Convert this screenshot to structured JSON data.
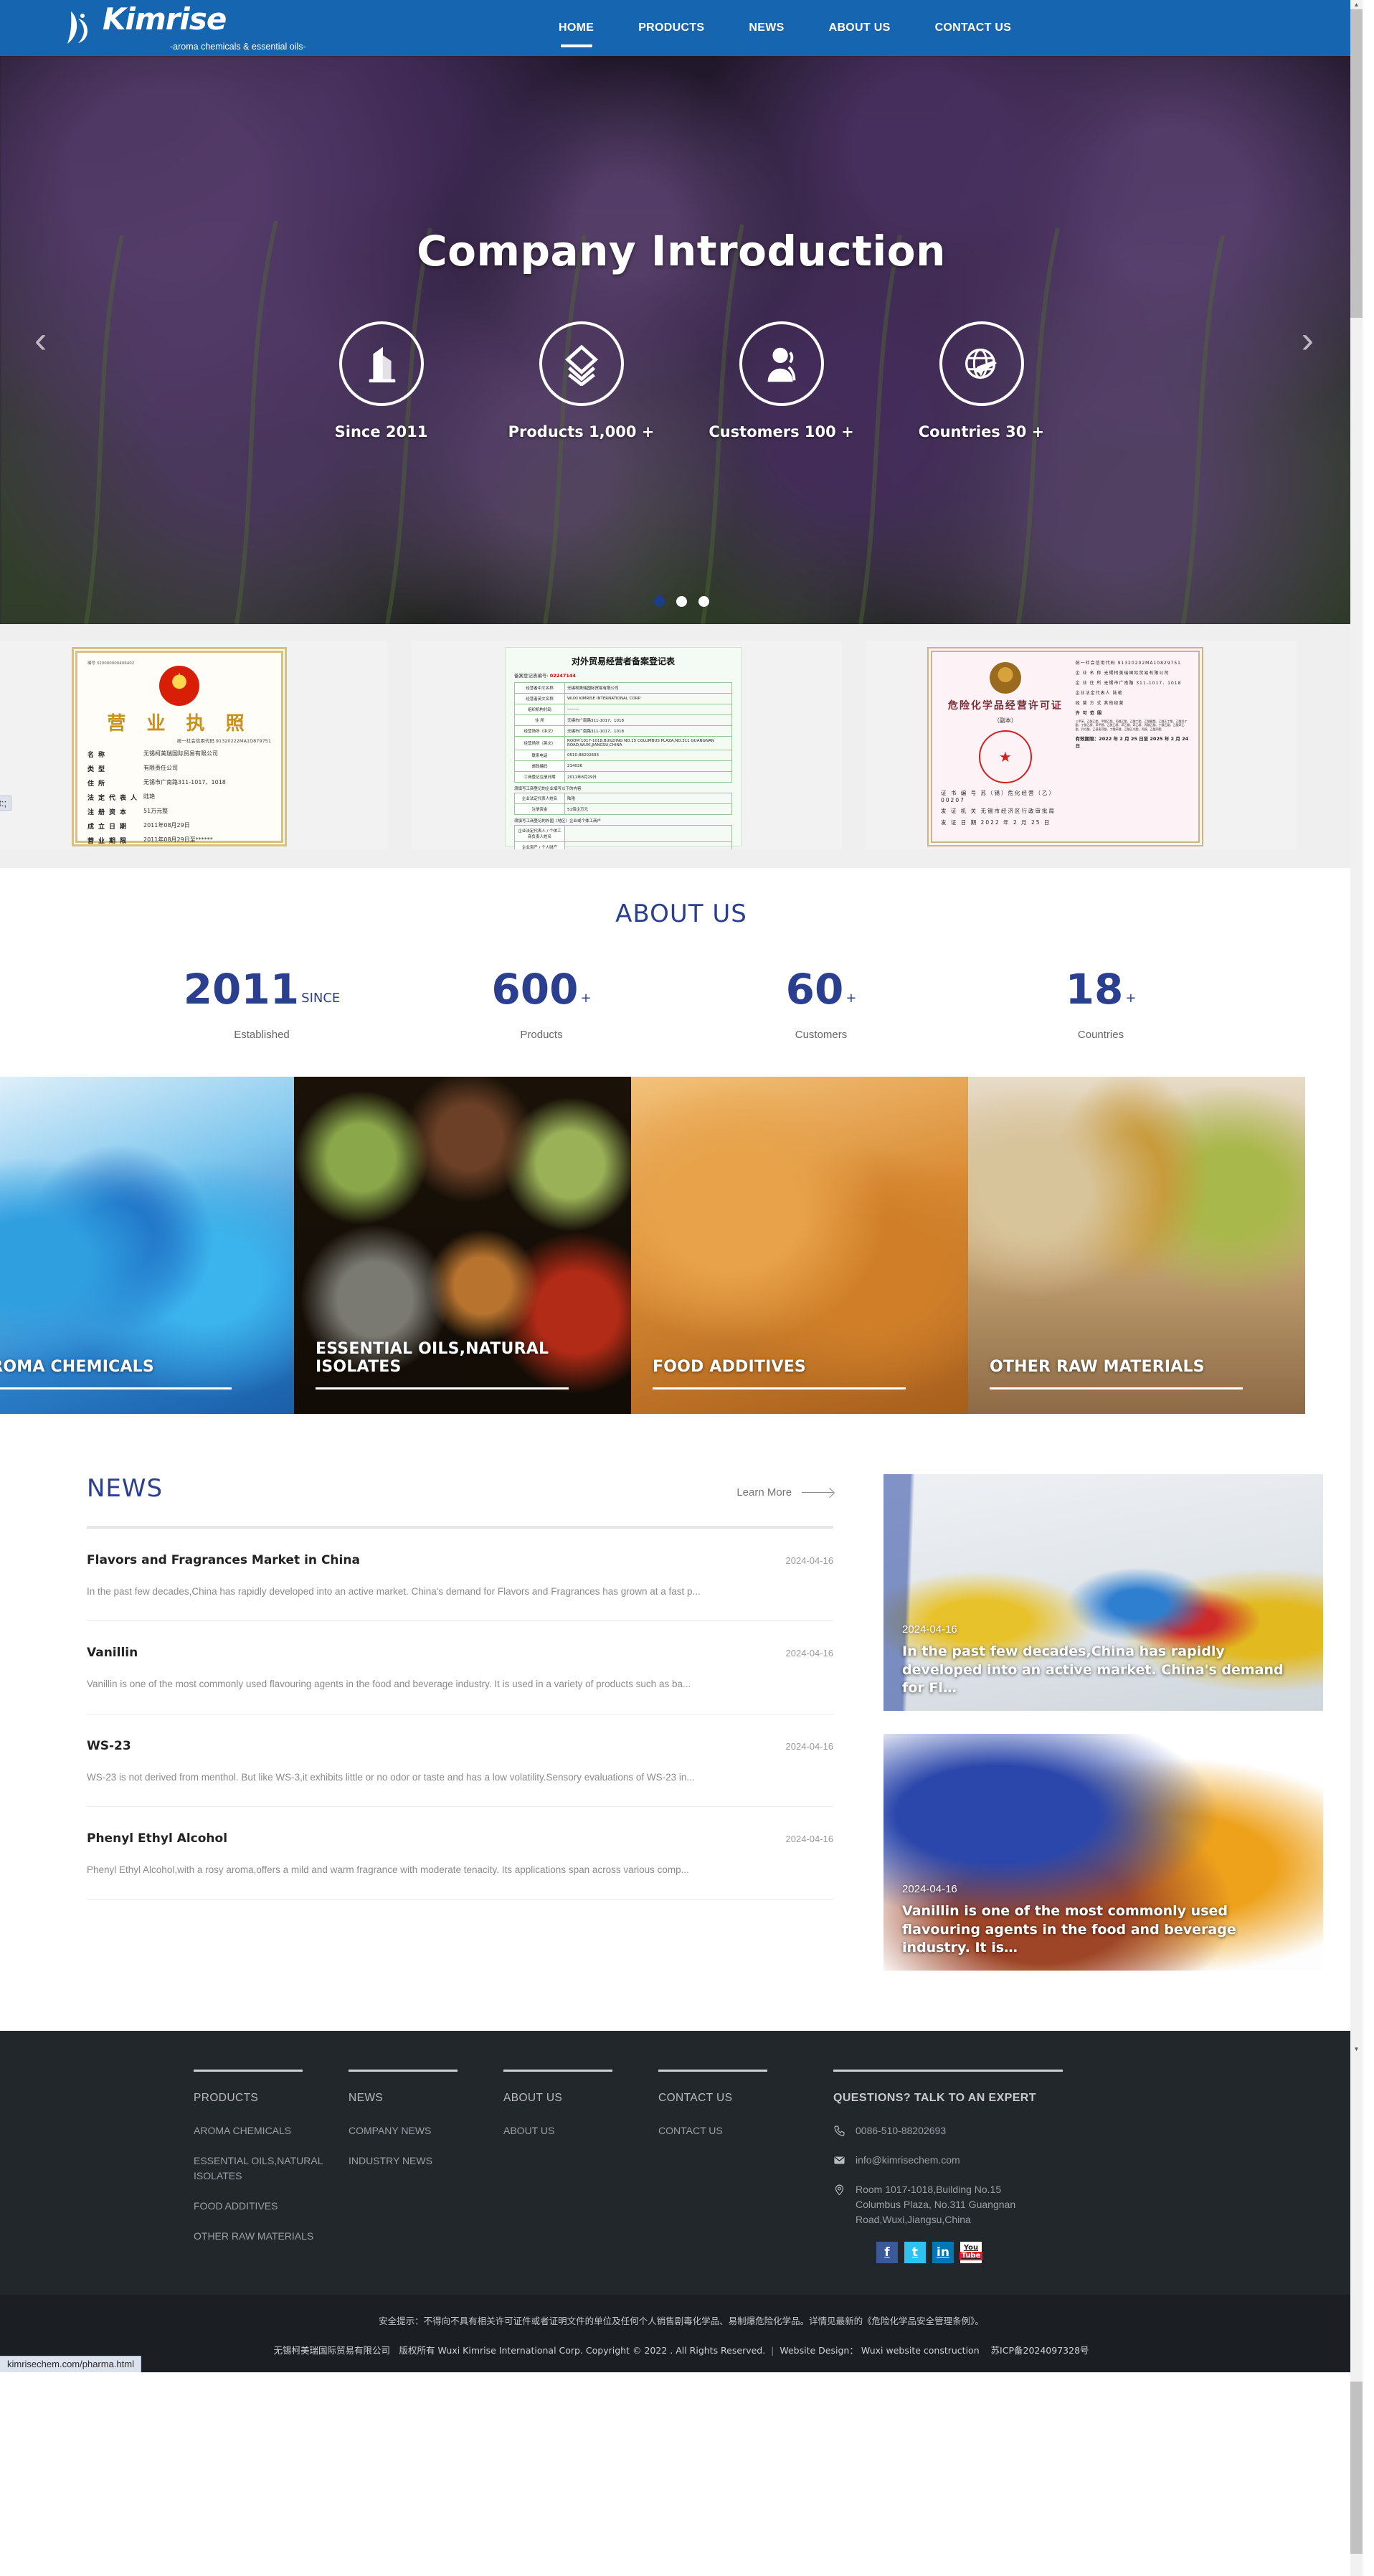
{
  "header": {
    "brand": "Kimrise",
    "tagline": "-aroma chemicals & essential oils-",
    "nav": [
      {
        "label": "HOME",
        "active": true
      },
      {
        "label": "PRODUCTS",
        "active": false
      },
      {
        "label": "NEWS",
        "active": false
      },
      {
        "label": "ABOUT US",
        "active": false
      },
      {
        "label": "CONTACT US",
        "active": false
      }
    ]
  },
  "hero": {
    "title": "Company Introduction",
    "stats": [
      {
        "icon": "building-icon",
        "label": "Since 2011"
      },
      {
        "icon": "layers-icon",
        "label": "Products 1,000 +"
      },
      {
        "icon": "users-icon",
        "label": "Customers 100 +"
      },
      {
        "icon": "globe-plane-icon",
        "label": "Countries 30 +"
      }
    ],
    "prev": "‹",
    "next": "›",
    "dots": 3,
    "active_dot": 0
  },
  "certificates": [
    {
      "name": "business-license",
      "title": "营 业 执 照",
      "code_label": "统一社会信用代码 91320222MA1D879751",
      "serial": "编号 320000000406402",
      "rows": [
        {
          "k": "名称",
          "v": "无锡柯美瑞国际贸易有限公司"
        },
        {
          "k": "类型",
          "v": "有限责任公司"
        },
        {
          "k": "住所",
          "v": "无锡市广南路311-1017、1018"
        },
        {
          "k": "法定代表人",
          "v": "陆艳"
        },
        {
          "k": "注册资本",
          "v": "51万元整"
        },
        {
          "k": "成立日期",
          "v": "2011年08月29日"
        },
        {
          "k": "营业期限",
          "v": "2011年08月29日至******"
        }
      ]
    },
    {
      "name": "foreign-trade-registration",
      "title": "对外贸易经营者备案登记表",
      "reg_no_label": "备案登记表编号:",
      "reg_no": "02247144",
      "rows": [
        {
          "k": "经营者中文名称",
          "v": "无锡柯美瑞国际贸易有限公司"
        },
        {
          "k": "经营者英文名称",
          "v": "WUXI KIMRISE INTERNATIONAL CORP."
        },
        {
          "k": "组织机构代码",
          "v": "———"
        },
        {
          "k": "住 所",
          "v": "无锡市广南路311-1017、1018"
        },
        {
          "k": "经营场所（中文）",
          "v": "无锡市广南路311-1017、1018"
        },
        {
          "k": "经营场所（英文）",
          "v": "ROOM 1017-1018,BUILDING NO.15 COLUMBUS PLAZA,NO.311 GUANGNAN ROAD,WUXI,JIANGSU,CHINA"
        },
        {
          "k": "联系电话",
          "v": "0510-88202693"
        },
        {
          "k": "邮政编码",
          "v": "214026"
        },
        {
          "k": "工商登记注册日期",
          "v": "2011年8月29日"
        }
      ],
      "note1": "须填写工商登记的企业填写以下的内容",
      "rows2": [
        {
          "k": "企业法定代表人姓名",
          "v": "陆艳"
        },
        {
          "k": "注册资金",
          "v": "51佰企万元"
        }
      ],
      "note2": "须填写工商登记的外国（地区）企业或个体工商户",
      "rows3": [
        {
          "k": "企业法定代表人 / 个体工商负责人姓名",
          "v": ""
        },
        {
          "k": "企业资产 / 个人财产",
          "v": ""
        }
      ]
    },
    {
      "name": "hazardous-chemicals-permit",
      "title": "危险化学品经营许可证",
      "subtitle": "（副本）",
      "code_label": "统一社会信用代码",
      "code": "91320202MA10829751",
      "cert_no_label": "证 书 编 号",
      "cert_no": "苏（锡）危化经营（乙）00207",
      "issuer_label": "发 证 机 关",
      "issuer": "无锡市经济区行政审批局",
      "issue_date_label": "发 证 日 期",
      "issue_date": "2022 年 2 月 25 日",
      "fields": [
        {
          "k": "企 业 名 称",
          "v": "无锡柯美瑞国际贸易有限公司"
        },
        {
          "k": "企 业 住 所",
          "v": "无锡市广南路 311-1017、1018"
        },
        {
          "k": "企业法定代表人",
          "v": "陆艳"
        },
        {
          "k": "经 营 方 式",
          "v": "其他经营"
        }
      ],
      "scope_label": "许 可 范 围",
      "scope": "三甲苯、乙酰乙酯、甲酸乙酯、丙酸乙酯、乙酸丁酯、乙酸戴酯、乙酸正丁酯、乙酸异丁酯、丁酰乙醇、苯甲醇、乙酰乙醇、苯乙酮、苯乙醇、丙酸乙酯、丁酸乙酯、乙酸苯乙酯、异戊酸、乙基麦芽酚、丁酸苯酸、乙酸正戊酯、丙醇、乙酸丙酯",
      "valid_label": "有效期限：",
      "valid": "2022 年 2 月 25 日至 2025 年 2 月 24 日"
    }
  ],
  "tooltips": [
    {
      "name": "status-tooltip-javascript",
      "text": "javascript:;"
    },
    {
      "name": "status-tooltip-url-bottom",
      "text": "kimrisechem.com/pharma.html"
    }
  ],
  "about": {
    "heading": "ABOUT US",
    "stats": [
      {
        "number": "2011",
        "suffix": "SINCE",
        "caption": "Established"
      },
      {
        "number": "600",
        "suffix": "+",
        "caption": "Products"
      },
      {
        "number": "60",
        "suffix": "+",
        "caption": "Customers"
      },
      {
        "number": "18",
        "suffix": "+",
        "caption": "Countries"
      }
    ]
  },
  "categories": [
    {
      "title": "AROMA CHEMICALS",
      "image": "test-tubes-blue"
    },
    {
      "title": "ESSENTIAL OILS,NATURAL ISOLATES",
      "image": "spices-bowls"
    },
    {
      "title": "FOOD ADDITIVES",
      "image": "bread-loaves"
    },
    {
      "title": "OTHER RAW MATERIALS",
      "image": "oil-bottles"
    }
  ],
  "news": {
    "heading": "NEWS",
    "learn_more": "Learn More",
    "items": [
      {
        "title": "Flavors and Fragrances Market in China",
        "date": "2024-04-16",
        "desc": "In the past few decades,China has rapidly developed into an active market. China's demand for Flavors and Fragrances has grown at a fast p..."
      },
      {
        "title": "Vanillin",
        "date": "2024-04-16",
        "desc": "Vanillin is one of the most commonly used flavouring agents in the food and beverage industry. It is used in a variety of products such as ba..."
      },
      {
        "title": "WS-23",
        "date": "2024-04-16",
        "desc": "WS-23 is not derived from menthol. But like WS-3,it exhibits little or no odor or taste and has a low volatility.Sensory evaluations of WS-23 in..."
      },
      {
        "title": "Phenyl Ethyl Alcohol",
        "date": "2024-04-16",
        "desc": "Phenyl Ethyl Alcohol,with a rosy aroma,offers a mild and warm fragrance with moderate tenacity. Its applications span across various comp..."
      }
    ],
    "cards": [
      {
        "date": "2024-04-16",
        "text": "In the past few decades,China has rapidly developed into an active market. China's demand for Fl…",
        "image": "lab-glassware"
      },
      {
        "date": "2024-04-16",
        "text": "Vanillin is one of the most commonly used flavouring agents in the food and beverage industry. It is…",
        "image": "colored-powders"
      }
    ]
  },
  "footer": {
    "columns": [
      {
        "heading": "PRODUCTS",
        "links": [
          "AROMA CHEMICALS",
          "ESSENTIAL OILS,NATURAL ISOLATES",
          "FOOD ADDITIVES",
          "OTHER RAW MATERIALS"
        ]
      },
      {
        "heading": "NEWS",
        "links": [
          "COMPANY NEWS",
          "INDUSTRY NEWS"
        ]
      },
      {
        "heading": "ABOUT US",
        "links": [
          "ABOUT US"
        ]
      },
      {
        "heading": "CONTACT US",
        "links": [
          "CONTACT US"
        ]
      }
    ],
    "contact": {
      "heading": "QUESTIONS? TALK TO AN EXPERT",
      "phone": "0086-510-88202693",
      "email": "info@kimrisechem.com",
      "address": "Room 1017-1018,Building No.15 Columbus Plaza, No.311 Guangnan Road,Wuxi,Jiangsu,China"
    },
    "socials": [
      {
        "name": "facebook-icon",
        "glyph": "f"
      },
      {
        "name": "twitter-icon",
        "glyph": "t"
      },
      {
        "name": "linkedin-icon",
        "glyph": "in"
      },
      {
        "name": "youtube-icon",
        "glyph": "You"
      }
    ],
    "safety_notice": "安全提示：不得向不具有相关许可证件或者证明文件的单位及任何个人销售剧毒化学品、易制爆危险化学品。详情见最新的《危险化学品安全管理条例》。",
    "copyright_cn": "无锡柯美瑞国际贸易有限公司　版权所有",
    "copyright_en": "Wuxi Kimrise International Corp. Copyright © 2022 . All Rights Reserved.",
    "website_design_label": "Website Design：",
    "website_design": "Wuxi website construction",
    "icp": "苏ICP备2024097328号"
  },
  "colors": {
    "brand_blue": "#1565b0",
    "accent_navy": "#2b3f91",
    "footer_bg": "#22272c",
    "footer_bottom_bg": "#1b1f23"
  }
}
